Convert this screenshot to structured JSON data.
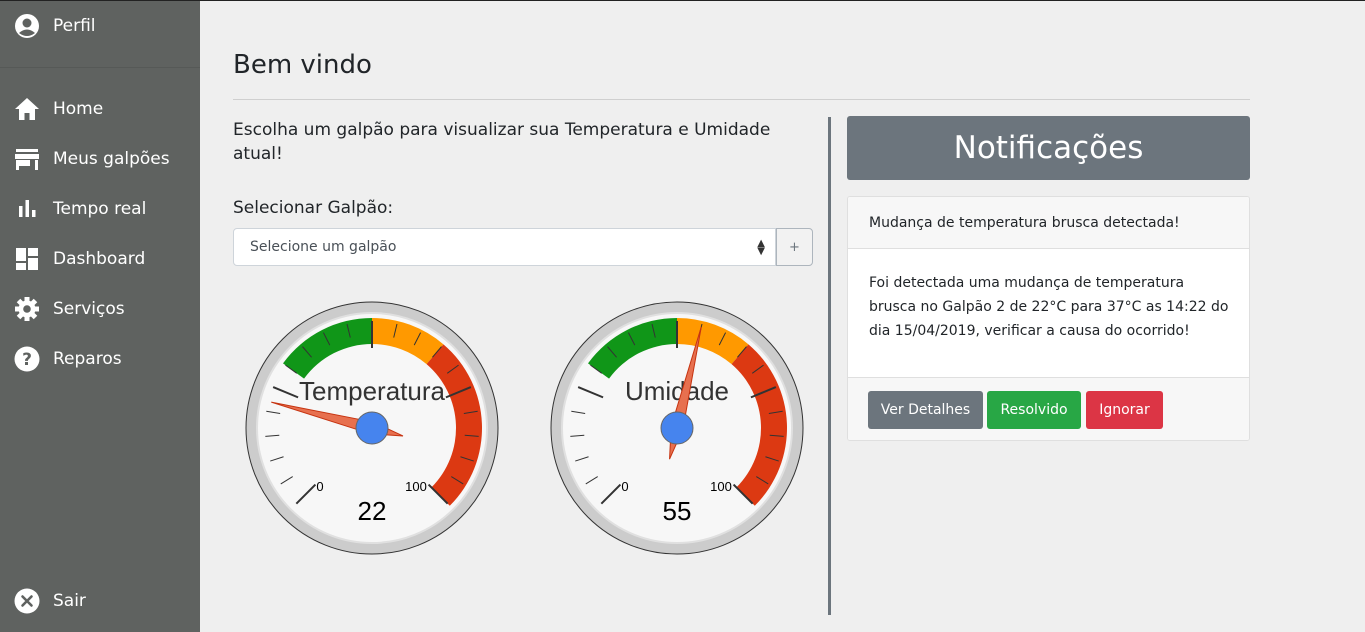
{
  "sidebar": {
    "profile_label": "Perfil",
    "items": [
      {
        "label": "Home",
        "icon": "home-icon"
      },
      {
        "label": "Meus galpões",
        "icon": "store-icon"
      },
      {
        "label": "Tempo real",
        "icon": "bar-chart-icon"
      },
      {
        "label": "Dashboard",
        "icon": "dashboard-icon"
      },
      {
        "label": "Serviços",
        "icon": "gear-icon"
      },
      {
        "label": "Reparos",
        "icon": "help-icon"
      }
    ],
    "logout_label": "Sair",
    "colors": {
      "background": "#5f6260"
    }
  },
  "main": {
    "title": "Bem vindo",
    "intro": "Escolha um galpão para visualizar sua Temperatura e Umidade atual!",
    "select_label": "Selecionar Galpão:",
    "select_value": "Selecione um galpão",
    "add_button": "+"
  },
  "gauges": [
    {
      "label": "Temperatura",
      "value": 22,
      "display": "22",
      "min": 0,
      "max": 100,
      "min_label": "0",
      "max_label": "100"
    },
    {
      "label": "Umidade",
      "value": 55,
      "display": "55",
      "min": 0,
      "max": 100,
      "min_label": "0",
      "max_label": "100"
    }
  ],
  "gauge_colors": {
    "green": "#109618",
    "orange": "#ff9900",
    "red": "#dc3912",
    "needle": "#e7704f",
    "hub": "#4684ee"
  },
  "notifications": {
    "header": "Notificações",
    "card_title": "Mudança de temperatura brusca detectada!",
    "card_body": "Foi detectada uma mudança de temperatura brusca no Galpão 2 de 22°C para 37°C as 14:22 do dia 15/04/2019, verificar a causa do ocorrido!",
    "buttons": {
      "details": "Ver Detalhes",
      "resolved": "Resolvido",
      "ignore": "Ignorar"
    }
  }
}
